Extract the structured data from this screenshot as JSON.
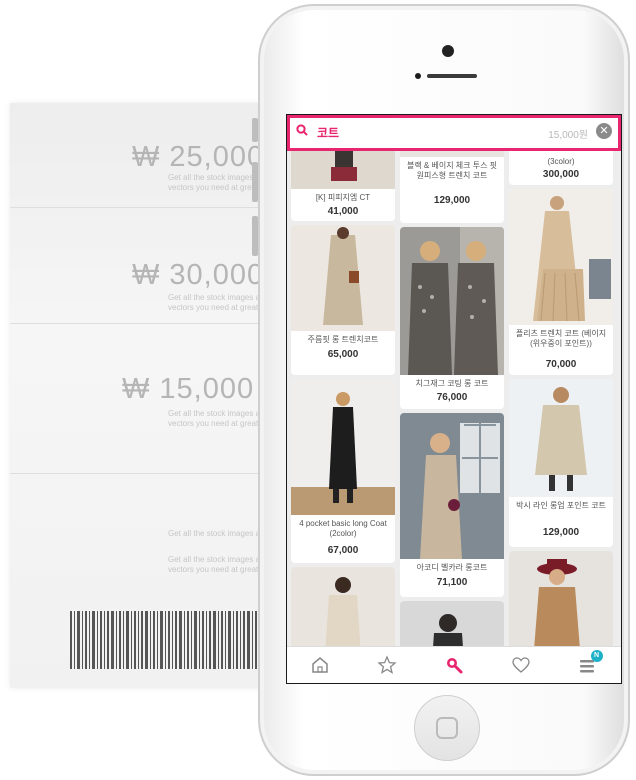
{
  "receipt": {
    "prices": [
      {
        "amount": "₩ 25,000",
        "note": "Get all the stock images and vectors you need at great"
      },
      {
        "amount": "₩ 30,000",
        "note": "Get all the stock images and vectors you need at great"
      },
      {
        "amount": "₩ 15,000",
        "note": "Get all the stock images and vectors you need at great"
      }
    ],
    "footer_notes": [
      "Get all the stock images and",
      "Get all the stock images and vectors you need at great"
    ]
  },
  "search": {
    "query": "코트",
    "price_filter": "15,000원",
    "clear_symbol": "✕"
  },
  "products": {
    "col1": [
      {
        "name": "[K] 피피지엠 CT",
        "price": "41,000"
      },
      {
        "name": "주름핏 롱 트렌치코트",
        "price": "65,000"
      },
      {
        "name": "4 pocket basic long Coat (2color)",
        "price": "67,000"
      },
      {
        "name": "",
        "price": ""
      }
    ],
    "col2": [
      {
        "name": "블랙 & 베이지 체크 투스 핏 원피스형 트렌치 코트",
        "price": "129,000"
      },
      {
        "name": "치그재그 코팅 롱 코트",
        "price": "76,000"
      },
      {
        "name": "아코디 벨카라 롱코트",
        "price": "71,100"
      },
      {
        "name": "",
        "price": ""
      }
    ],
    "col3": [
      {
        "name": "(3color)",
        "price": "300,000"
      },
      {
        "name": "플리츠 트렌치 코트 (베이지 (위우중이 포인트))",
        "price": "70,000"
      },
      {
        "name": "박시 라인 롱업 포인트 코트",
        "price": "129,000"
      },
      {
        "name": "",
        "price": ""
      }
    ]
  },
  "nav": {
    "badge": "N"
  },
  "colors": {
    "accent": "#e8266f",
    "badge": "#1fb1c8"
  }
}
